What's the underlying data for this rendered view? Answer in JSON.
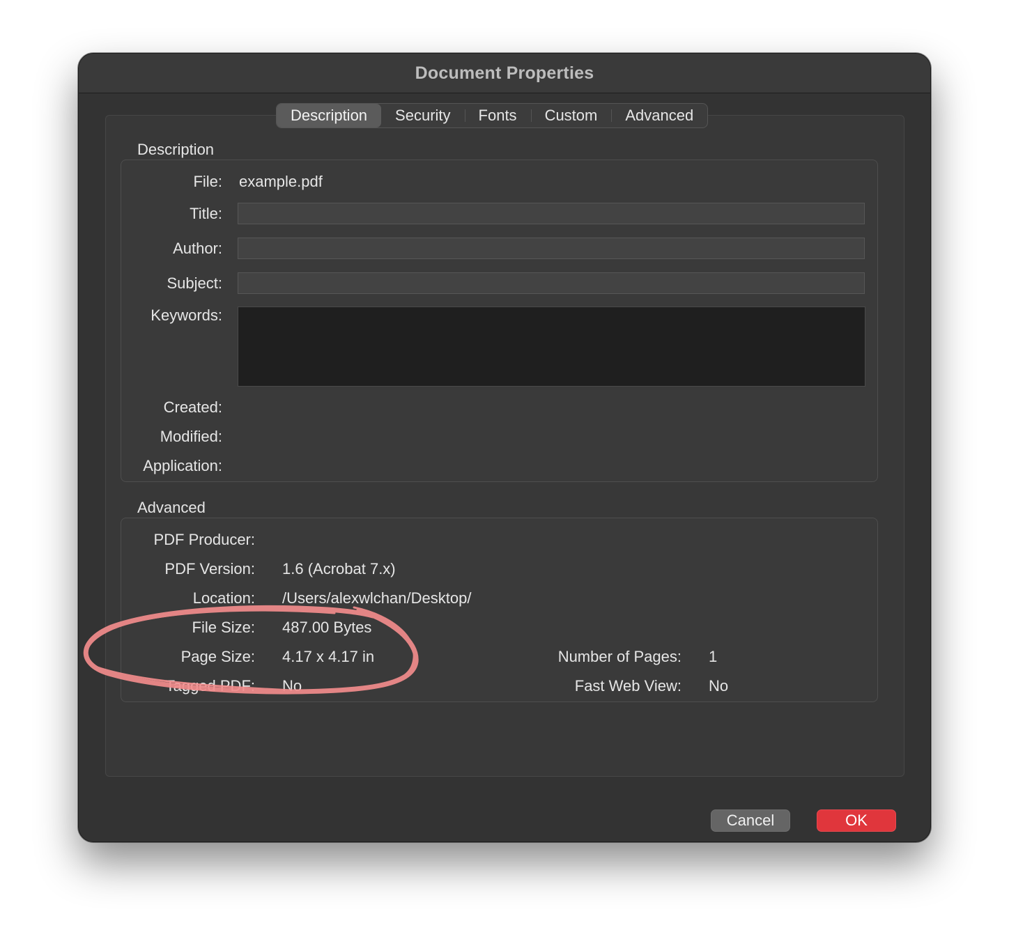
{
  "window": {
    "title": "Document Properties"
  },
  "tabs": [
    {
      "label": "Description",
      "active": true
    },
    {
      "label": "Security",
      "active": false
    },
    {
      "label": "Fonts",
      "active": false
    },
    {
      "label": "Custom",
      "active": false
    },
    {
      "label": "Advanced",
      "active": false
    }
  ],
  "description": {
    "section_title": "Description",
    "file_label": "File:",
    "file_value": "example.pdf",
    "title_label": "Title:",
    "title_value": "",
    "author_label": "Author:",
    "author_value": "",
    "subject_label": "Subject:",
    "subject_value": "",
    "keywords_label": "Keywords:",
    "keywords_value": "",
    "created_label": "Created:",
    "modified_label": "Modified:",
    "application_label": "Application:"
  },
  "advanced": {
    "section_title": "Advanced",
    "pdf_producer_label": "PDF Producer:",
    "pdf_version_label": "PDF Version:",
    "pdf_version_value": "1.6 (Acrobat 7.x)",
    "location_label": "Location:",
    "location_value": "/Users/alexwlchan/Desktop/",
    "file_size_label": "File Size:",
    "file_size_value": "487.00 Bytes",
    "page_size_label": "Page Size:",
    "page_size_value": "4.17 x 4.17 in",
    "tagged_pdf_label": "Tagged PDF:",
    "tagged_pdf_value": "No",
    "num_pages_label": "Number of Pages:",
    "num_pages_value": "1",
    "fast_web_view_label": "Fast Web View:",
    "fast_web_view_value": "No"
  },
  "buttons": {
    "cancel_label": "Cancel",
    "ok_label": "OK"
  },
  "colors": {
    "window_bg": "#333333",
    "accent_ok": "#e0363c",
    "annotation": "#f28c8c"
  }
}
